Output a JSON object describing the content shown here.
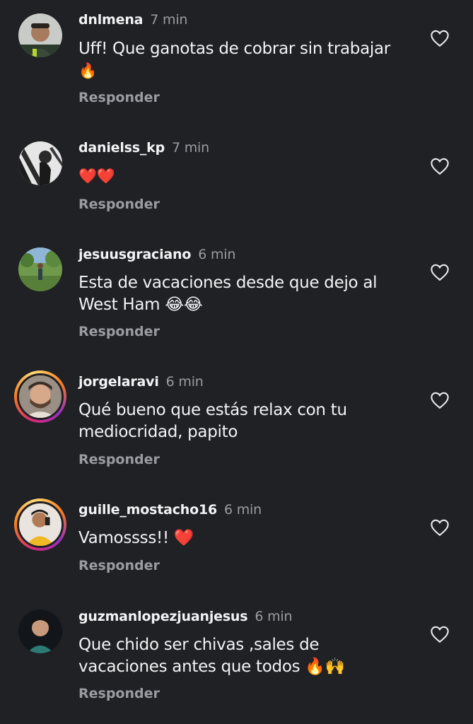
{
  "comments": [
    {
      "username": "dnlmena",
      "time": "7 min",
      "text_line1": "Uff! Que ganotas de cobrar sin trabajar",
      "text_line2": "🔥",
      "reply_label": "Responder",
      "like_icon": "heart-outline-icon"
    },
    {
      "username": "danielss_kp",
      "time": "7 min",
      "text_line1": "❤️❤️",
      "reply_label": "Responder",
      "like_icon": "heart-outline-icon"
    },
    {
      "username": "jesuusgraciano",
      "time": "6 min",
      "text_line1": "Esta de vacaciones desde que dejo al",
      "text_line2": "West Ham 😂😂",
      "reply_label": "Responder",
      "like_icon": "heart-outline-icon"
    },
    {
      "username": "jorgelaravi",
      "time": "6 min",
      "text_line1": "Qué bueno que estás relax con tu",
      "text_line2": "mediocridad, papito",
      "reply_label": "Responder",
      "like_icon": "heart-outline-icon"
    },
    {
      "username": "guille_mostacho16",
      "time": "6 min",
      "text_line1": "Vamossss!! ❤️",
      "reply_label": "Responder",
      "like_icon": "heart-outline-icon"
    },
    {
      "username": "guzmanlopezjuanjesus",
      "time": "6 min",
      "text_line1": "Que chido ser chivas ,sales de",
      "text_line2": "vacaciones antes que todos 🔥🙌",
      "reply_label": "Responder",
      "like_icon": "heart-outline-icon"
    }
  ]
}
